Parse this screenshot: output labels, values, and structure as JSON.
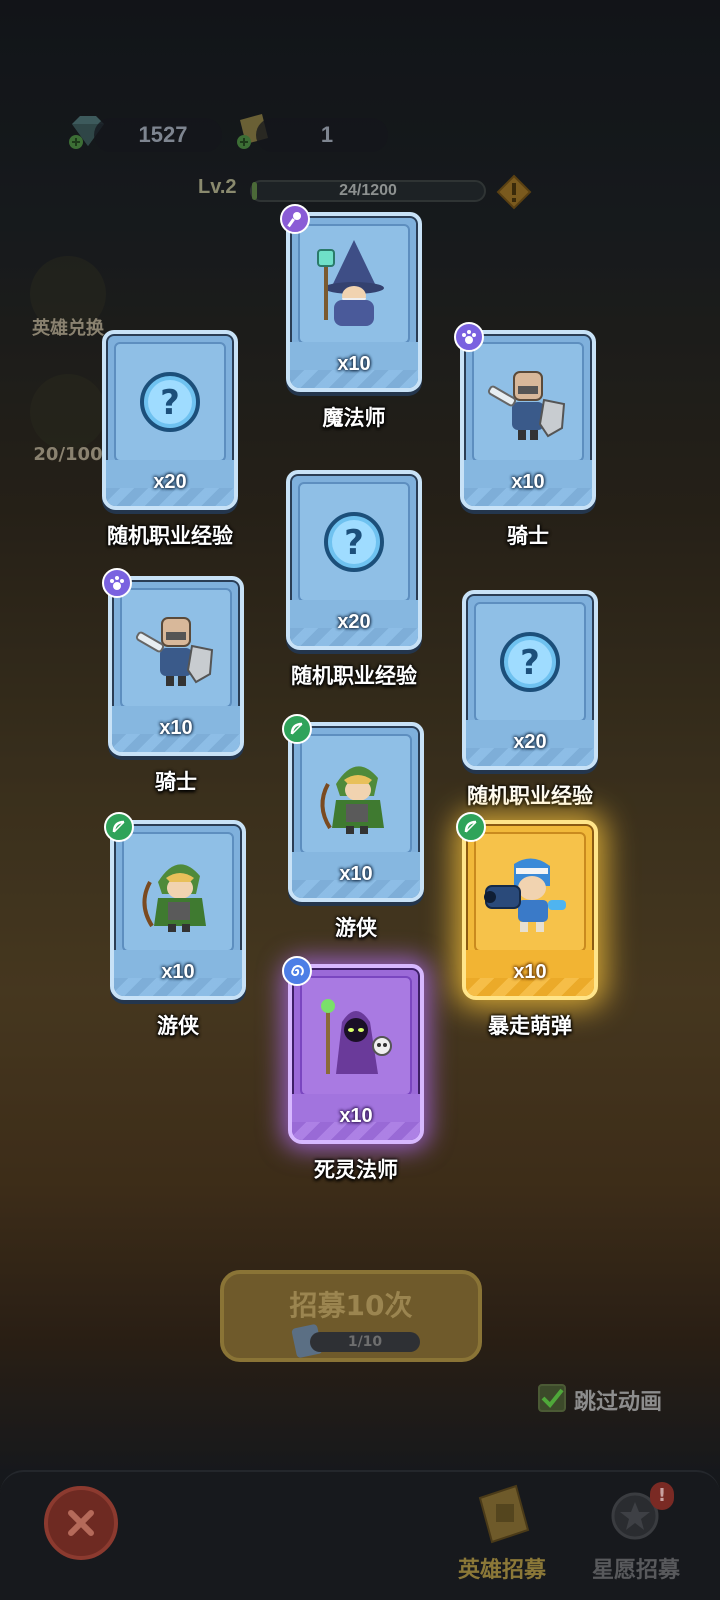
{
  "currency": {
    "gems": "1527",
    "tickets": "1"
  },
  "level": {
    "label": "Lv.2",
    "progress_text": "24/1200",
    "progress_fraction": 0.02
  },
  "side": {
    "hero_exchange": "英雄兑换",
    "star_progress": "20/100"
  },
  "cards": [
    {
      "name": "魔法师",
      "count": "x10",
      "badge": "mage-badge",
      "rarity": "blue"
    },
    {
      "name": "随机职业经验",
      "count": "x20",
      "badge": "",
      "rarity": "blue"
    },
    {
      "name": "骑士",
      "count": "x10",
      "badge": "knight-badge",
      "rarity": "blue"
    },
    {
      "name": "随机职业经验",
      "count": "x20",
      "badge": "",
      "rarity": "blue"
    },
    {
      "name": "骑士",
      "count": "x10",
      "badge": "knight-badge",
      "rarity": "blue"
    },
    {
      "name": "随机职业经验",
      "count": "x20",
      "badge": "",
      "rarity": "blue"
    },
    {
      "name": "游侠",
      "count": "x10",
      "badge": "ranger-badge",
      "rarity": "blue"
    },
    {
      "name": "游侠",
      "count": "x10",
      "badge": "ranger-badge",
      "rarity": "blue"
    },
    {
      "name": "暴走萌弹",
      "count": "x10",
      "badge": "ranger-badge",
      "rarity": "gold"
    },
    {
      "name": "死灵法师",
      "count": "x10",
      "badge": "necro-badge",
      "rarity": "purple"
    }
  ],
  "recruit": {
    "label": "招募10次",
    "progress": "1/10"
  },
  "skip": {
    "label": "跳过动画",
    "checked": true
  },
  "nav": {
    "hero_recruit": "英雄招募",
    "wish_recruit": "星愿招募",
    "notice": "!"
  },
  "colors": {
    "blue_card": "#7fb0dc",
    "gold_card": "#f1b93a",
    "purple_card": "#9b6ad8"
  }
}
